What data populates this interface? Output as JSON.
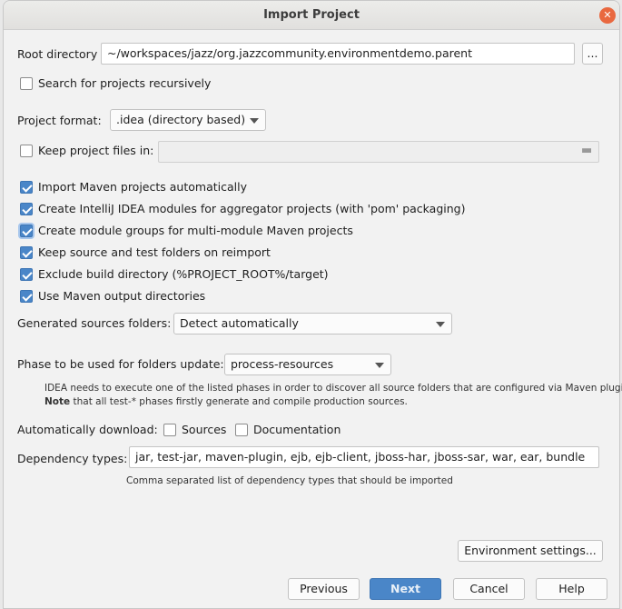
{
  "title": "Import Project",
  "root_dir": {
    "label": "Root directory",
    "value": "~/workspaces/jazz/org.jazzcommunity.environmentdemo.parent",
    "browse": "..."
  },
  "search_recursive": {
    "label": "Search for projects recursively",
    "checked": false
  },
  "project_format": {
    "label": "Project format:",
    "value": ".idea (directory based)"
  },
  "keep_files": {
    "label": "Keep project files in:",
    "checked": false,
    "value": ""
  },
  "options": [
    {
      "label": "Import Maven projects automatically",
      "checked": true
    },
    {
      "label": "Create IntelliJ IDEA modules for aggregator projects (with 'pom' packaging)",
      "checked": true
    },
    {
      "label": "Create module groups for multi-module Maven projects",
      "checked": true
    },
    {
      "label": "Keep source and test folders on reimport",
      "checked": true
    },
    {
      "label": "Exclude build directory (%PROJECT_ROOT%/target)",
      "checked": true
    },
    {
      "label": "Use Maven output directories",
      "checked": true
    }
  ],
  "generated_sources": {
    "label": "Generated sources folders:",
    "value": "Detect automatically"
  },
  "phase": {
    "label": "Phase to be used for folders update:",
    "value": "process-resources",
    "note1": "IDEA needs to execute one of the listed phases in order to discover all source folders that are configured via Maven plugins.",
    "note_bold": "Note",
    "note2": " that all test-* phases firstly generate and compile production sources."
  },
  "auto_download": {
    "label": "Automatically download:",
    "sources": "Sources",
    "documentation": "Documentation"
  },
  "dependency_types": {
    "label": "Dependency types:",
    "value": "jar, test-jar, maven-plugin, ejb, ejb-client, jboss-har, jboss-sar, war, ear, bundle",
    "hint": "Comma separated list of dependency types that should be imported"
  },
  "buttons": {
    "env": "Environment settings...",
    "previous": "Previous",
    "next": "Next",
    "cancel": "Cancel",
    "help": "Help"
  },
  "colors": {
    "accent": "#4a86c8",
    "close": "#e9683f"
  }
}
